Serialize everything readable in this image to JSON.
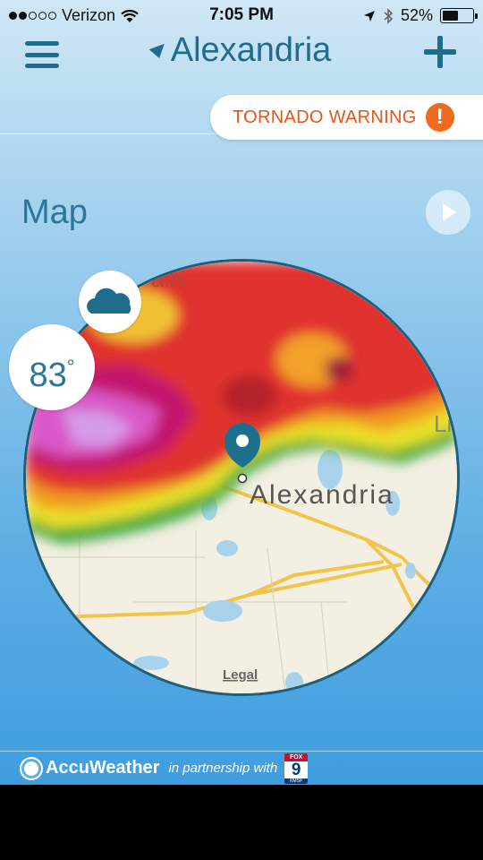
{
  "status_bar": {
    "carrier": "Verizon",
    "time": "7:05 PM",
    "battery": "52%",
    "battery_level": 0.52,
    "signal_bars": 2,
    "icons": [
      "wifi-icon",
      "location-arrow-icon",
      "bluetooth-icon",
      "battery-icon"
    ]
  },
  "header": {
    "title": "Alexandria",
    "menu_icon": "hamburger-menu-icon",
    "add_icon": "plus-icon"
  },
  "alert": {
    "label": "TORNADO WARNING",
    "icon": "!",
    "color": "#e4551b"
  },
  "map_section": {
    "title": "Map",
    "play_icon": "play-icon",
    "place_label": "Alexandria",
    "legal_label": "Legal",
    "edge_labels": [
      "alls",
      "Li"
    ]
  },
  "current": {
    "temperature": "83",
    "degree_symbol": "°",
    "condition_icon": "cloud-icon"
  },
  "footer": {
    "brand": "AccuWeather",
    "partner_text": "in partnership with",
    "partner_logo_top": "FOX",
    "partner_logo_number": "9",
    "partner_logo_bottom": "KMSP"
  },
  "colors": {
    "accent": "#1f6d8c",
    "warning": "#e4551b",
    "background_top": "#cfe7f6",
    "background_bottom": "#3f9ddf"
  }
}
